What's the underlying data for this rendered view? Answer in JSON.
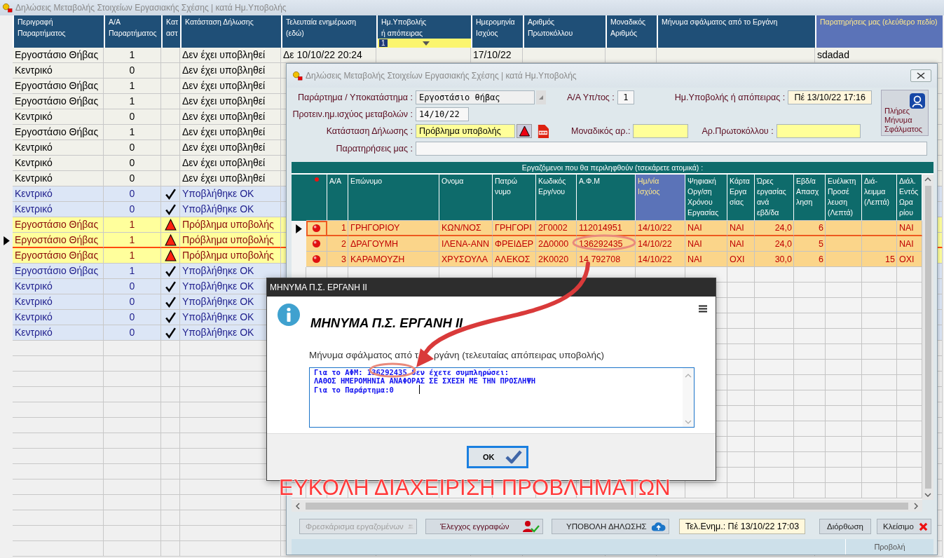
{
  "window": {
    "title": "Δηλώσεις Μεταβολής Στοιχείων Εργασιακής Σχέσης | κατά Ημ.Υποβολής"
  },
  "main_table": {
    "columns": [
      {
        "label": "Περιγραφή\nΠαραρτήματος",
        "highlight": false
      },
      {
        "label": "Α/Α\nΠαραρτήματος",
        "highlight": false
      },
      {
        "label": "Κατ\nαστ",
        "highlight": false
      },
      {
        "label": "Κατάσταση Δήλωσης",
        "highlight": false
      },
      {
        "label": "Τελευταία ενημέρωση\n(εδώ)",
        "highlight": false
      },
      {
        "label": "Ημ.Υποβολής\nή απόπειρας",
        "highlight": false
      },
      {
        "label": "Ημερομηνία\nΙσχύος",
        "highlight": false
      },
      {
        "label": "Αριθμός\nΠρωτοκόλλου",
        "highlight": false
      },
      {
        "label": "Μοναδικός\nΑριθμός",
        "highlight": false
      },
      {
        "label": "Μήνυμα σφάλματος από το Εργάνη",
        "highlight": false
      },
      {
        "label": "Παρατηρήσεις μας (ελεύθερο πεδίο)",
        "highlight": true
      }
    ],
    "filter_value": "1",
    "rows": [
      {
        "branch": "Εργοστάσιο Θήβας",
        "aa": "1",
        "kind": "pending",
        "status": "Δεν έχει υποβληθεί",
        "last_update": "Δε 10/10/22 20:24",
        "effective": "17/10/22",
        "notes": "sdadad",
        "selected": false
      },
      {
        "branch": "Κεντρικό",
        "aa": "0",
        "kind": "pending",
        "status": "Δεν έχει υποβληθεί",
        "selected": false
      },
      {
        "branch": "Εργοστάσιο Θήβας",
        "aa": "1",
        "kind": "pending",
        "status": "Δεν έχει υποβληθεί",
        "selected": false
      },
      {
        "branch": "Εργοστάσιο Θήβας",
        "aa": "1",
        "kind": "pending",
        "status": "Δεν έχει υποβληθεί",
        "selected": false
      },
      {
        "branch": "Κεντρικό",
        "aa": "0",
        "kind": "pending",
        "status": "Δεν έχει υποβληθεί",
        "selected": false
      },
      {
        "branch": "Εργοστάσιο Θήβας",
        "aa": "1",
        "kind": "pending",
        "status": "Δεν έχει υποβληθεί",
        "selected": false
      },
      {
        "branch": "Κεντρικό",
        "aa": "0",
        "kind": "pending",
        "status": "Δεν έχει υποβληθεί",
        "selected": false
      },
      {
        "branch": "Κεντρικό",
        "aa": "0",
        "kind": "pending",
        "status": "Δεν έχει υποβληθεί",
        "selected": false
      },
      {
        "branch": "Κεντρικό",
        "aa": "0",
        "kind": "pending",
        "status": "Δεν έχει υποβληθεί",
        "selected": false
      },
      {
        "branch": "Κεντρικό",
        "aa": "0",
        "kind": "ok",
        "status": "Υποβλήθηκε ΟΚ",
        "selected": false
      },
      {
        "branch": "Κεντρικό",
        "aa": "0",
        "kind": "ok",
        "status": "Υποβλήθηκε ΟΚ",
        "selected": false
      },
      {
        "branch": "Εργοστάσιο Θήβας",
        "aa": "1",
        "kind": "problem",
        "status": "Πρόβλημα υποβολής",
        "selected": false
      },
      {
        "branch": "Εργοστάσιο Θήβας",
        "aa": "1",
        "kind": "problem",
        "status": "Πρόβλημα υποβολής",
        "selected": true
      },
      {
        "branch": "Εργοστάσιο Θήβας",
        "aa": "1",
        "kind": "problem",
        "status": "Πρόβλημα υποβολής",
        "selected": false
      },
      {
        "branch": "Εργοστάσιο Θήβας",
        "aa": "1",
        "kind": "ok",
        "status": "Υποβλήθηκε ΟΚ",
        "selected": false
      },
      {
        "branch": "Κεντρικό",
        "aa": "0",
        "kind": "ok",
        "status": "Υποβλήθηκε ΟΚ",
        "selected": false
      },
      {
        "branch": "Κεντρικό",
        "aa": "0",
        "kind": "ok",
        "status": "Υποβλήθηκε ΟΚ",
        "selected": false
      },
      {
        "branch": "Κεντρικό",
        "aa": "0",
        "kind": "ok",
        "status": "Υποβλήθηκε ΟΚ",
        "selected": false
      },
      {
        "branch": "Κεντρικό",
        "aa": "0",
        "kind": "ok",
        "status": "Υποβλήθηκε ΟΚ",
        "selected": false
      }
    ]
  },
  "dialog": {
    "title": "Δηλώσεις Μεταβολής Στοιχείων Εργασιακής Σχέσης | κατά Ημ.Υποβολής",
    "branch_label": "Παράρτημα / Υποκατάστημα :",
    "branch_value": "Εργοστάσιο θήβας",
    "aa_label": "Α/Α Υπ/τος :",
    "aa_value": "1",
    "submitted_label": "Ημ.Υποβολής ή απόπειρας :",
    "submitted_value": "Πέ 13/10/22 17:16",
    "full_error_button": "Πλήρες Μήνυμα Σφάλματος",
    "effective_label": "Προτειν.ημ.ισχύος μεταβολών :",
    "effective_value": "14/10/22",
    "status_label": "Κατάσταση Δήλωσης :",
    "status_value": "Πρόβλημα υποβολής",
    "unique_label": "Μοναδικός αρ.:",
    "protocol_label": "Αρ.Πρωτοκόλλου :",
    "notes_label": "Παρατηρήσεις μας :",
    "grid_title": "Εργαζόμενοι που θα περιληφθούν (τσεκάρετε ατομικά) :",
    "columns": [
      {
        "label": "Α/Α",
        "highlight": false
      },
      {
        "label": "Επώνυμο",
        "highlight": false
      },
      {
        "label": "Ονομα",
        "highlight": false
      },
      {
        "label": "Πατρώ\nνυμο",
        "highlight": false
      },
      {
        "label": "Κωδικός\nΕργ/νου",
        "highlight": false
      },
      {
        "label": "Α.Φ.Μ",
        "highlight": false
      },
      {
        "label": "Ημ/νία\nΙσχύος",
        "highlight": true
      },
      {
        "label": "Ψηφιακή\nΟργ/ση\nΧρόνου\nΕργασίας",
        "highlight": false
      },
      {
        "label": "Κάρτα\nΕργα\nσίας",
        "highlight": false
      },
      {
        "label": "Ώρες\nεργασίας\nανά\nεβδ/δα",
        "highlight": false
      },
      {
        "label": "Εβδ/α\nΑπασχ\nληση",
        "highlight": false
      },
      {
        "label": "Ευέλικτη\nΠροσέ\nλευση\n(Λεπτά)",
        "highlight": false
      },
      {
        "label": "Διά-\nλειμμα\n(Λεπτά)",
        "highlight": false
      },
      {
        "label": "Διάλ.\nΕντός\nΩρα\nρίου",
        "highlight": false
      }
    ],
    "employees": [
      {
        "selected": true,
        "checked": true,
        "aa": "1",
        "surname": "ΓΡΗΓΟΡΙΟΥ",
        "name": "ΚΩΝ/ΝΟΣ",
        "father": "ΓΡΗΓΟΡΙ",
        "code": "2Γ0002",
        "afm": "112014951",
        "date": "14/10/22",
        "digital": "ΝΑΙ",
        "card": "ΝΑΙ",
        "hours": "24,0",
        "weekly": "6",
        "inside": "ΝΑΙ"
      },
      {
        "selected": false,
        "checked": true,
        "aa": "2",
        "surname": "ΔΡΑΓΟΥΜΗ",
        "name": "ΙΛΕΝΑ-ΑΝΝ",
        "father": "ΦΡΕΙΔΕΡ",
        "code": "2Δ0000",
        "afm": "136292435",
        "date": "14/10/22",
        "digital": "ΝΑΙ",
        "card": "ΝΑΙ",
        "hours": "24,0",
        "weekly": "5",
        "inside": "ΝΑΙ"
      },
      {
        "selected": false,
        "checked": true,
        "aa": "3",
        "surname": "ΚΑΡΑΜΟΥΖΗ",
        "name": "ΧΡΥΣΟΥΛΑ",
        "father": "ΑΛΕΚΟΣ",
        "code": "2Κ0020",
        "afm": "14 792708",
        "date": "14/10/22",
        "digital": "ΝΑΙ",
        "card": "ΟΧΙ",
        "hours": "30,0",
        "weekly": "6",
        "break_min": "15",
        "inside": "ΟΧΙ"
      }
    ],
    "buttons": [
      {
        "label": "Φρεσκάρισμα εργαζομένων",
        "kind": "refresh",
        "disabled": true
      },
      {
        "label": "Έλεγχος εγγραφών",
        "kind": "check",
        "disabled": false
      },
      {
        "label": "ΥΠΟΒΟΛΗ ΔΗΛΩΣΗΣ",
        "kind": "upload",
        "disabled": false
      }
    ],
    "last_update": "Τελ.Ενημ.: Πέ 13/10/22 17:03",
    "fix_button": "Διόρθωση",
    "close_button": "Κλείσιμο",
    "status_bar": "Προβολή"
  },
  "message_box": {
    "title": "ΜΗΝΥΜΑ Π.Σ. ΕΡΓΑΝΗ ΙΙ",
    "heading": "ΜΗΝΥΜΑ Π.Σ. ΕΡΓΑΝΗ ΙΙ",
    "label_parts": [
      "Μήνυμα σφάλματος από τ",
      "ργάνη (τελευταίας απόπειρας υποβολής)"
    ],
    "lines": [
      "Για το ΑΦΜ: 136292435 δεν έχετε συμπληρώσει:",
      "ΛΑΘΟΣ ΗΜΕΡΟΜΗΝΙΑ ΑΝΑΦΟΡΑΣ ΣΕ ΣΧΕΣΗ ΜΕ ΤΗΝ ΠΡΟΣΛΗΨΗ",
      "Για το Παράρτημα:0"
    ],
    "ok_button": "OK"
  },
  "annotation": {
    "text": "ΕΥΚΟΛΗ ΔΙΑΧΕΙΡΙΣΗ ΠΡΟΒΛΗΜΑΤΩΝ"
  }
}
